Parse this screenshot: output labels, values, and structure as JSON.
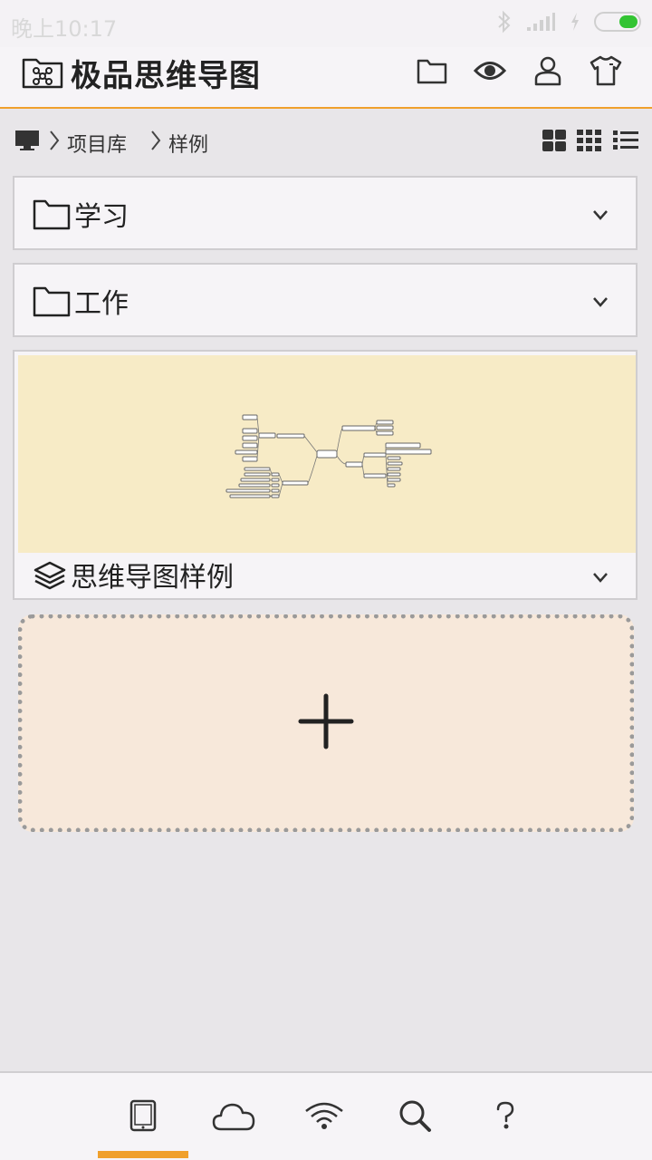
{
  "status_bar": {
    "time": "晚上10:17",
    "battery_color": "#33c433"
  },
  "app": {
    "title": "极品思维导图",
    "accent": "#f0a02c"
  },
  "header_actions": [
    {
      "name": "folder-icon"
    },
    {
      "name": "eye-icon"
    },
    {
      "name": "user-icon"
    },
    {
      "name": "shirt-icon"
    }
  ],
  "breadcrumb": {
    "items": [
      "项目库",
      "样例"
    ]
  },
  "folders": [
    {
      "label": "学习"
    },
    {
      "label": "工作"
    }
  ],
  "mindmap": {
    "label": "思维导图样例",
    "thumb_color": "#f7ebc6"
  },
  "bottom_nav": {
    "tabs": [
      "tablet-icon",
      "cloud-icon",
      "wifi-icon",
      "search-icon",
      "help-icon"
    ],
    "active": 0
  }
}
